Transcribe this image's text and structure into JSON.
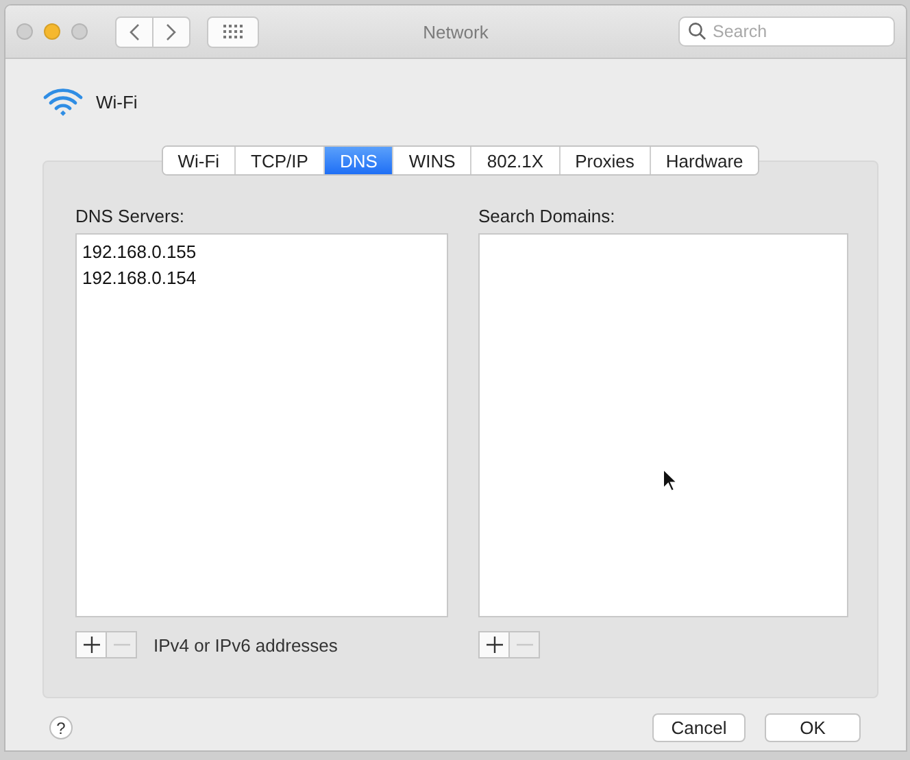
{
  "window": {
    "title": "Network",
    "controls": [
      {
        "color": "#cfcfcf"
      },
      {
        "color": "#f5b82e"
      },
      {
        "color": "#cfcfcf"
      }
    ]
  },
  "search": {
    "placeholder": "Search"
  },
  "service": {
    "name": "Wi-Fi"
  },
  "tabs": [
    {
      "label": "Wi-Fi",
      "selected": false
    },
    {
      "label": "TCP/IP",
      "selected": false
    },
    {
      "label": "DNS",
      "selected": true
    },
    {
      "label": "WINS",
      "selected": false
    },
    {
      "label": "802.1X",
      "selected": false
    },
    {
      "label": "Proxies",
      "selected": false
    },
    {
      "label": "Hardware",
      "selected": false
    }
  ],
  "dns_servers": {
    "label": "DNS Servers:",
    "items": [
      "192.168.0.155",
      "192.168.0.154"
    ],
    "buttons": [
      {
        "kind": "add",
        "disabled": false
      },
      {
        "kind": "remove",
        "disabled": true
      }
    ],
    "hint": "IPv4 or IPv6 addresses"
  },
  "search_domains": {
    "label": "Search Domains:",
    "buttons": [
      {
        "kind": "add",
        "disabled": false
      },
      {
        "kind": "remove",
        "disabled": true
      }
    ]
  },
  "help": {
    "label": "?"
  },
  "buttons": [
    "Cancel",
    "OK"
  ]
}
